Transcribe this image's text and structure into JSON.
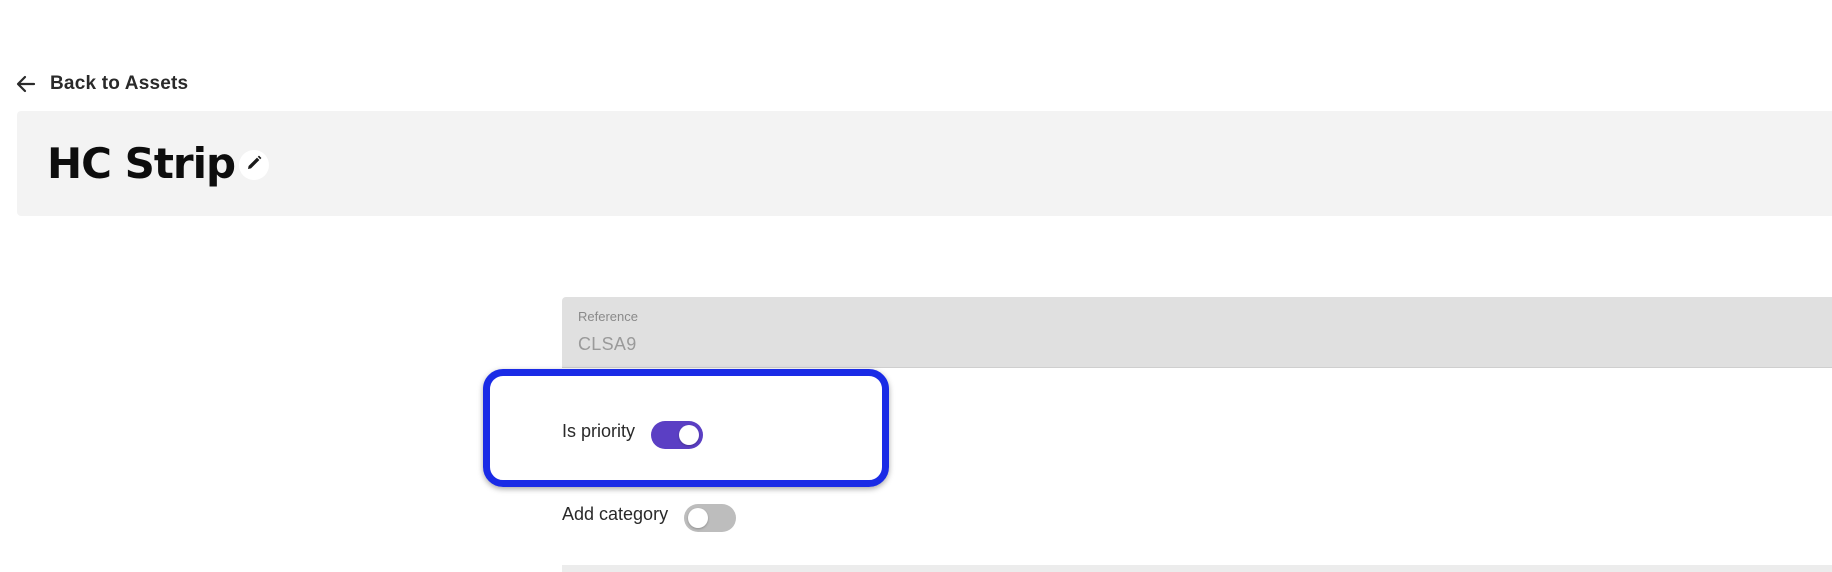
{
  "navigation": {
    "back_label": "Back to Assets",
    "back_icon": "arrow-left-icon"
  },
  "header": {
    "title": "HC Strip",
    "edit_icon": "pencil-icon"
  },
  "form": {
    "reference": {
      "label": "Reference",
      "value": "CLSA9"
    },
    "is_priority": {
      "label": "Is priority",
      "enabled": true
    },
    "add_category": {
      "label": "Add category",
      "enabled": false
    }
  },
  "colors": {
    "highlight": "#1a2be6",
    "toggle_on": "#5b3fc4",
    "toggle_off": "#bdbdbd",
    "header_bg": "#f3f3f3",
    "field_bg": "#e0e0e0"
  }
}
